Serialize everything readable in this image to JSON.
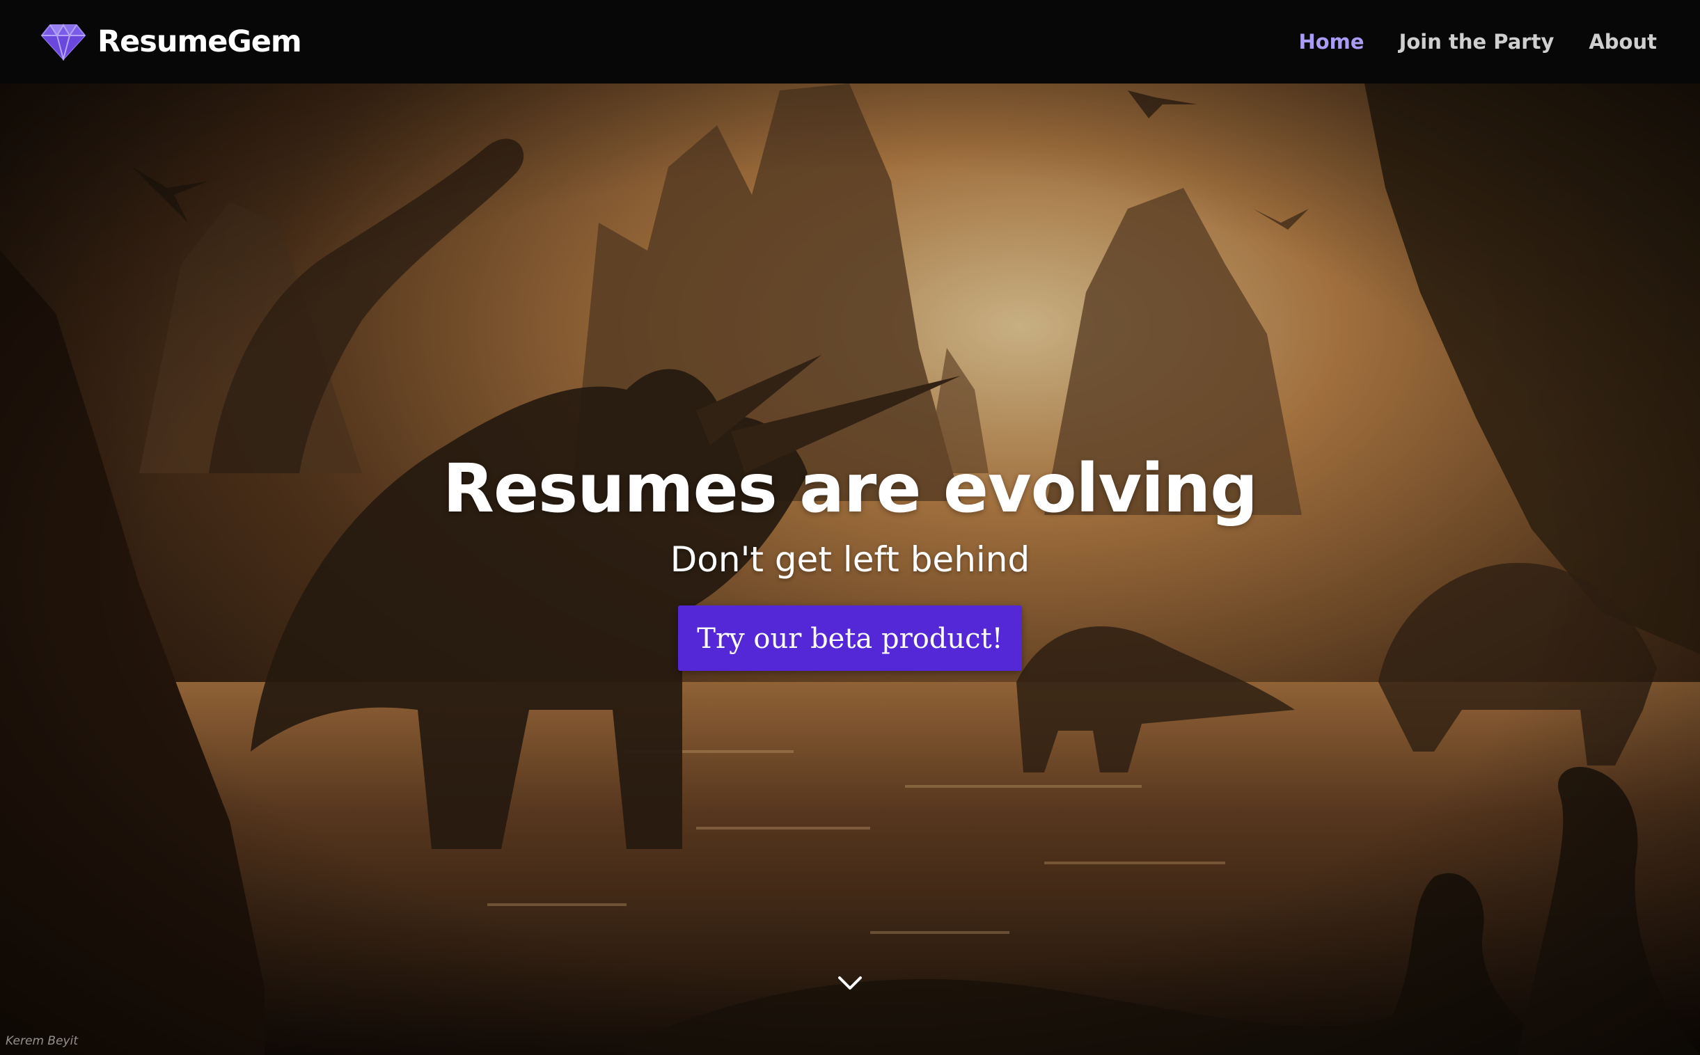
{
  "navbar": {
    "brand": {
      "icon": "diamond-gem-icon",
      "name": "ResumeGem"
    },
    "links": [
      {
        "label": "Home",
        "active": true
      },
      {
        "label": "Join the Party",
        "active": false
      },
      {
        "label": "About",
        "active": false
      }
    ]
  },
  "hero": {
    "background": "prehistoric landscape illustration with dinosaurs at sunset",
    "title": "Resumes are evolving",
    "subtitle": "Don't get left behind",
    "cta_label": "Try our beta product!",
    "scroll_icon": "chevron-down-icon",
    "credit": "Kerem Beyit"
  },
  "colors": {
    "navbar_bg": "#070707",
    "active_link": "#a99cf5",
    "inactive_link": "#cfcfcf",
    "cta_bg": "#5428d6",
    "brand_icon": "#7b5ce6"
  }
}
